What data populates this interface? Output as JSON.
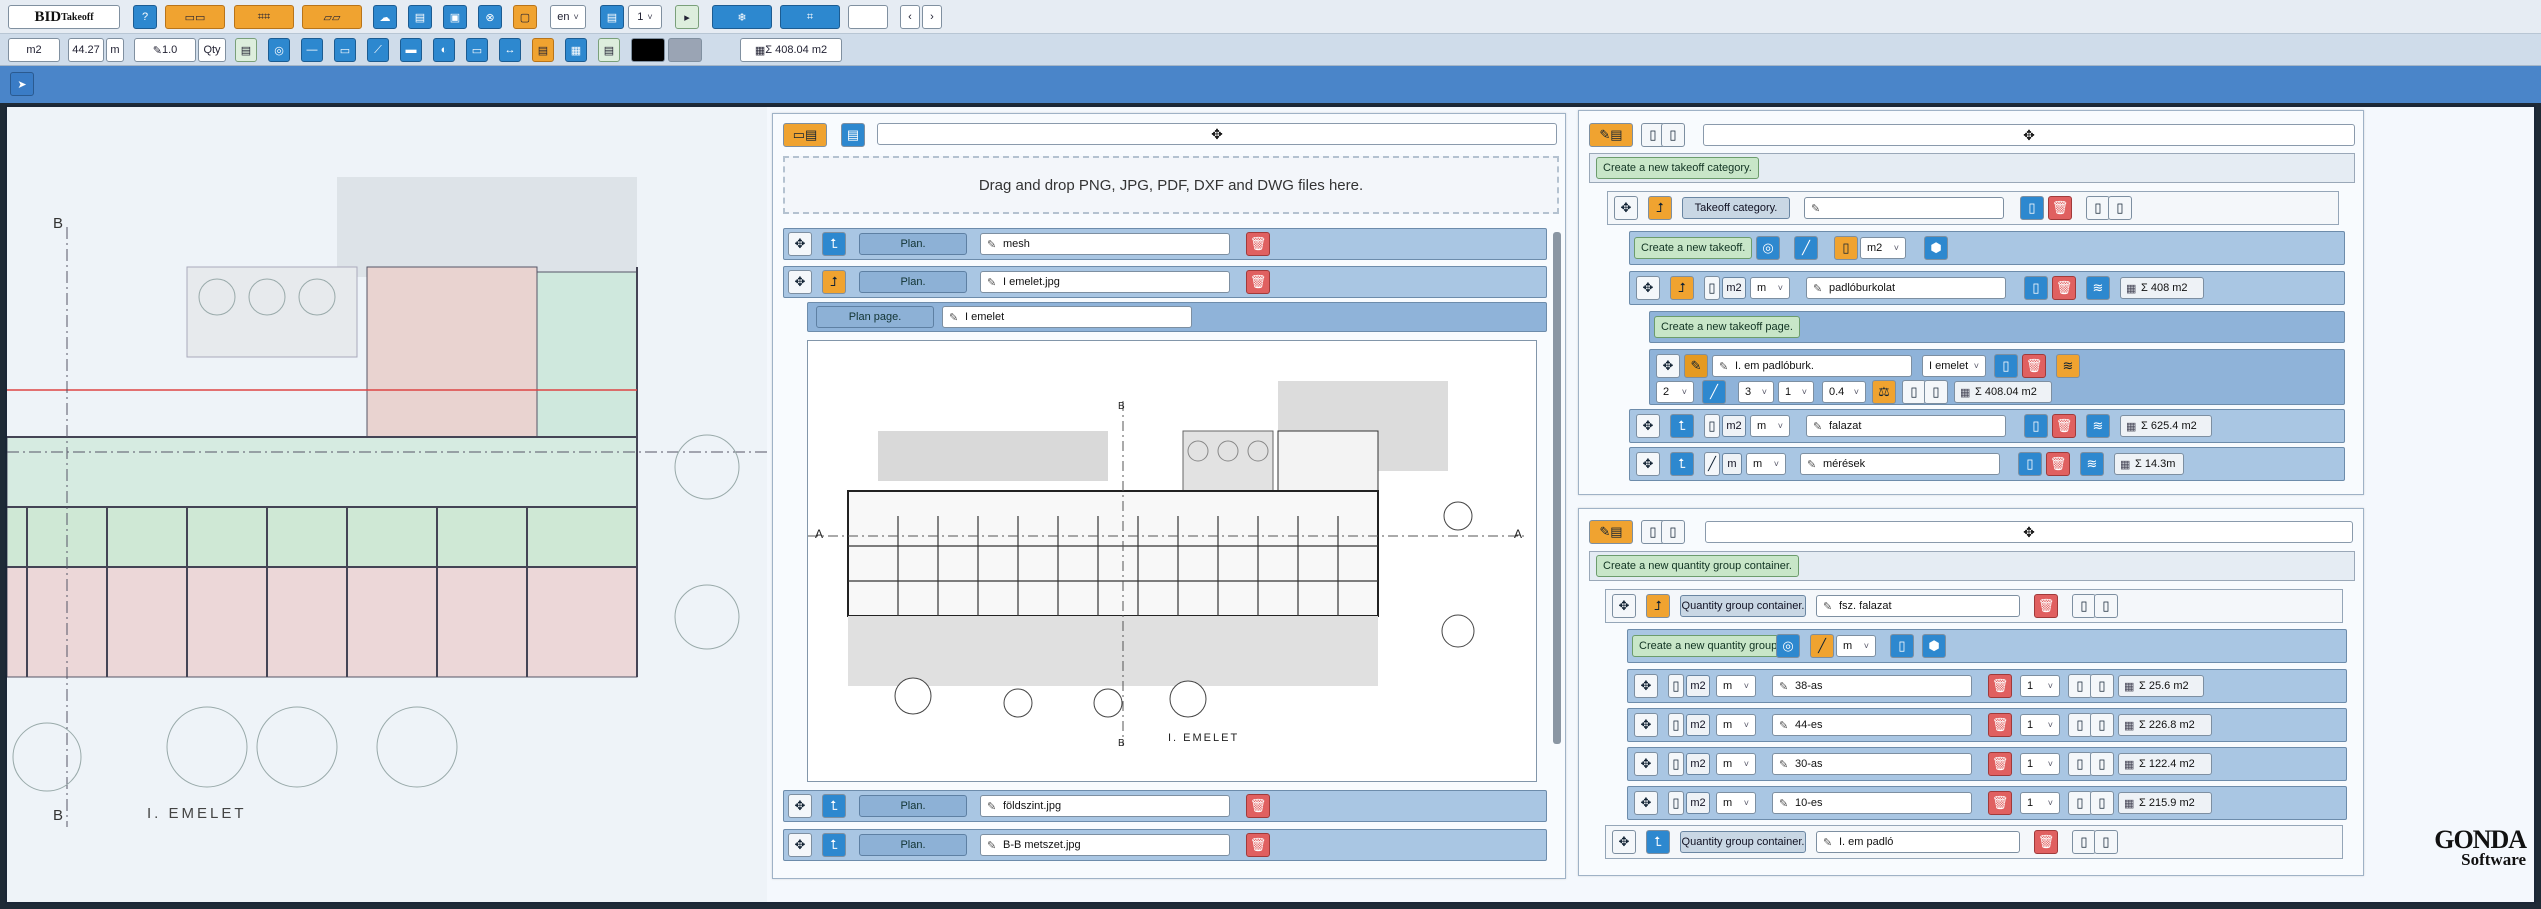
{
  "app": {
    "brand_main": "BID",
    "brand_sub": "Takeoff",
    "language": "en",
    "page_number": "1"
  },
  "toolbar2": {
    "unit": "m2",
    "length_value": "44.27",
    "length_unit": "m",
    "multiplier": "1.0",
    "qty_label": "Qty",
    "sum_total": "Σ 408.04 m2"
  },
  "plans_panel": {
    "drop_text": "Drag and drop PNG, JPG, PDF, DXF and DWG files here.",
    "plan_label": "Plan.",
    "plans": [
      {
        "name": "mesh"
      },
      {
        "name": "I emelet.jpg"
      },
      {
        "name": "földszint.jpg"
      },
      {
        "name": "B-B metszet.jpg"
      }
    ],
    "plan_page_label": "Plan page.",
    "plan_page_name": "I emelet",
    "drawing_caption": "I.  EMELET",
    "section_a": "A",
    "section_b": "B"
  },
  "takeoff_panel": {
    "create_category": "Create a new takeoff category.",
    "category_label": "Takeoff category.",
    "category_name": "",
    "create_takeoff": "Create a new takeoff.",
    "unit_m2": "m2",
    "unit_m": "m",
    "takeoffs": [
      {
        "unit": "m2",
        "name": "padlóburkolat",
        "sum": "Σ 408 m2"
      },
      {
        "unit": "m2",
        "name": "falazat",
        "sum": "Σ 625.4 m2"
      },
      {
        "unit": "m",
        "name": "mérések",
        "sum": "Σ 14.3m"
      }
    ],
    "create_page": "Create a new takeoff page.",
    "page": {
      "name": "I. em padlóburk.",
      "plan": "I emelet",
      "decimals": "2",
      "mult_a": "3",
      "mult_b": "1",
      "height": "0.4",
      "sum": "Σ 408.04 m2"
    }
  },
  "qty_panel": {
    "create_container": "Create a new quantity group container.",
    "container_label": "Quantity group container.",
    "containers": [
      {
        "name": "fsz. falazat"
      },
      {
        "name": "I. em padló"
      }
    ],
    "create_group": "Create a new quantity group.",
    "group_unit": "m",
    "groups": [
      {
        "unit": "m2",
        "sub_unit": "m",
        "name": "38-as",
        "factor": "1",
        "sum": "Σ 25.6 m2"
      },
      {
        "unit": "m2",
        "sub_unit": "m",
        "name": "44-es",
        "factor": "1",
        "sum": "Σ 226.8 m2"
      },
      {
        "unit": "m2",
        "sub_unit": "m",
        "name": "30-as",
        "factor": "1",
        "sum": "Σ 122.4 m2"
      },
      {
        "unit": "m2",
        "sub_unit": "m",
        "name": "10-es",
        "factor": "1",
        "sum": "Σ 215.9 m2"
      }
    ]
  },
  "background_plan": {
    "caption": "I.  EMELET",
    "section_b": "B"
  },
  "footer": {
    "logo_top": "GONDA",
    "logo_bottom": "Software"
  }
}
